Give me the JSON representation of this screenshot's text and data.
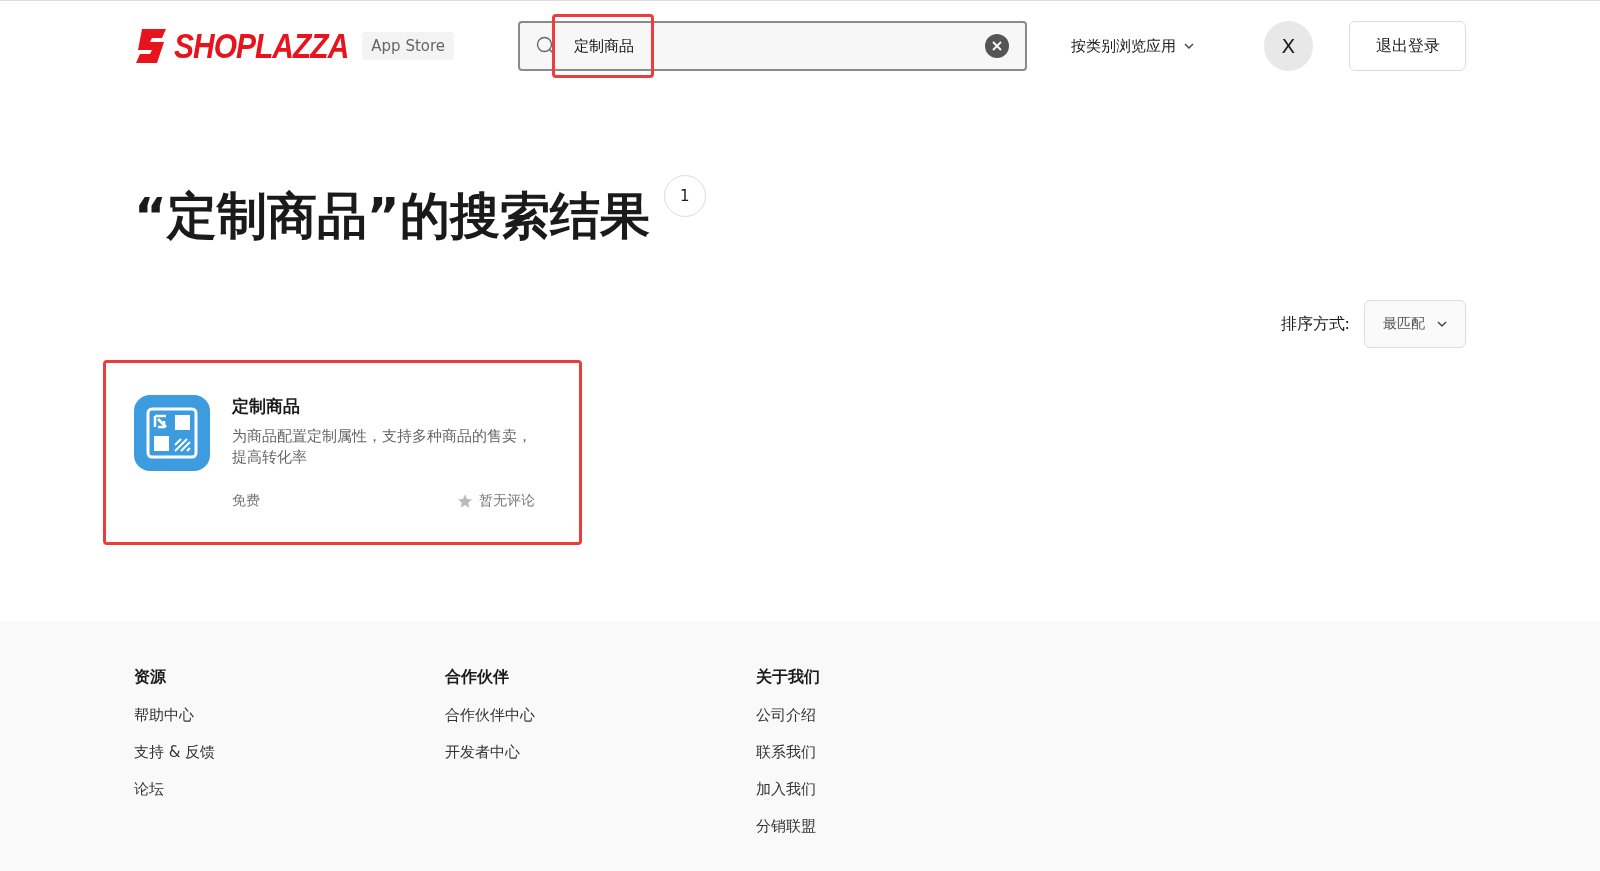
{
  "header": {
    "logo_text": "SHOPLAZZA",
    "store_badge": "App Store",
    "search": {
      "value": "定制商品"
    },
    "browse_menu": "按类别浏览应用",
    "avatar": "X",
    "logout": "退出登录"
  },
  "results": {
    "title": "“定制商品”的搜索结果",
    "count": "1",
    "sort_label": "排序方式:",
    "sort_value": "最匹配"
  },
  "apps": [
    {
      "name": "定制商品",
      "description": "为商品配置定制属性，支持多种商品的售卖，提高转化率",
      "price": "免费",
      "reviews": "暂无评论"
    }
  ],
  "footer": {
    "columns": [
      {
        "title": "资源",
        "links": [
          "帮助中心",
          "支持 & 反馈",
          "论坛"
        ]
      },
      {
        "title": "合作伙伴",
        "links": [
          "合作伙伴中心",
          "开发者中心"
        ]
      },
      {
        "title": "关于我们",
        "links": [
          "公司介绍",
          "联系我们",
          "加入我们",
          "分销联盟"
        ]
      }
    ]
  }
}
